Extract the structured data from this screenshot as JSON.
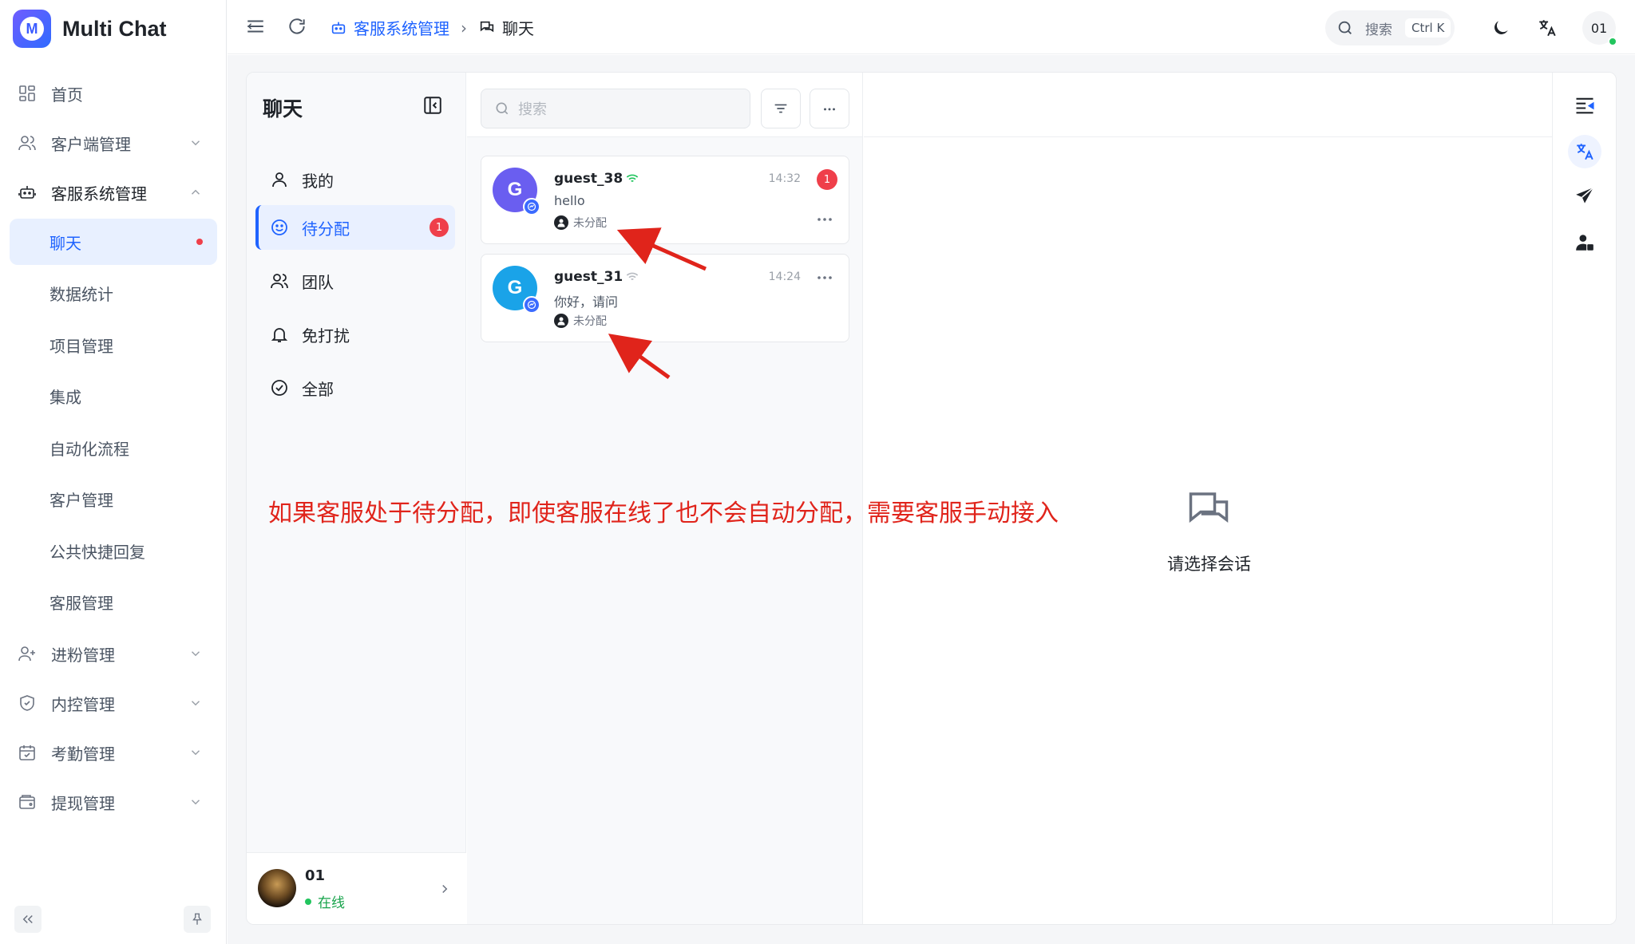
{
  "app": {
    "name": "Multi Chat",
    "logo_letter": "M"
  },
  "sidebar": {
    "items": [
      {
        "label": "首页",
        "icon": "dashboard-icon"
      },
      {
        "label": "客户端管理",
        "icon": "users-icon",
        "expandable": true
      },
      {
        "label": "客服系统管理",
        "icon": "robot-icon",
        "expandable": true,
        "expanded": true
      }
    ],
    "sub_items": [
      {
        "label": "聊天",
        "active": true,
        "dot": true
      },
      {
        "label": "数据统计"
      },
      {
        "label": "项目管理"
      },
      {
        "label": "集成"
      },
      {
        "label": "自动化流程"
      },
      {
        "label": "客户管理"
      },
      {
        "label": "公共快捷回复"
      },
      {
        "label": "客服管理"
      }
    ],
    "items_after": [
      {
        "label": "进粉管理",
        "icon": "user-plus-icon"
      },
      {
        "label": "内控管理",
        "icon": "shield-icon"
      },
      {
        "label": "考勤管理",
        "icon": "calendar-check-icon"
      },
      {
        "label": "提现管理",
        "icon": "wallet-icon"
      }
    ]
  },
  "header": {
    "breadcrumb": [
      "客服系统管理",
      "聊天"
    ],
    "search_label": "搜索",
    "search_shortcut": "Ctrl K",
    "user_initials": "01"
  },
  "chat": {
    "title": "聊天",
    "categories": [
      {
        "label": "我的",
        "icon": "user-icon"
      },
      {
        "label": "待分配",
        "icon": "smile-icon",
        "active": true,
        "badge": "1"
      },
      {
        "label": "团队",
        "icon": "team-icon"
      },
      {
        "label": "免打扰",
        "icon": "bell-icon"
      },
      {
        "label": "全部",
        "icon": "check-circle-icon"
      }
    ],
    "me": {
      "name": "01",
      "status": "在线"
    },
    "search_placeholder": "搜索",
    "conversations": [
      {
        "avatar_letter": "G",
        "avatar_color": "#6a5ef0",
        "name": "guest_38",
        "time": "14:32",
        "message": "hello",
        "assign": "未分配",
        "unread": "1",
        "signal_color": "#22c55e"
      },
      {
        "avatar_letter": "G",
        "avatar_color": "#1aa3e8",
        "name": "guest_31",
        "time": "14:24",
        "message": "你好，请问",
        "assign": "未分配",
        "signal_color": "#b8bcc2"
      }
    ],
    "empty_text": "请选择会话"
  },
  "annotation": "如果客服处于待分配，即使客服在线了也不会自动分配，需要客服手动接入",
  "colors": {
    "accent": "#1f63ff",
    "danger": "#ef3f4a",
    "online": "#22c55e",
    "annotation": "#e0241b"
  }
}
